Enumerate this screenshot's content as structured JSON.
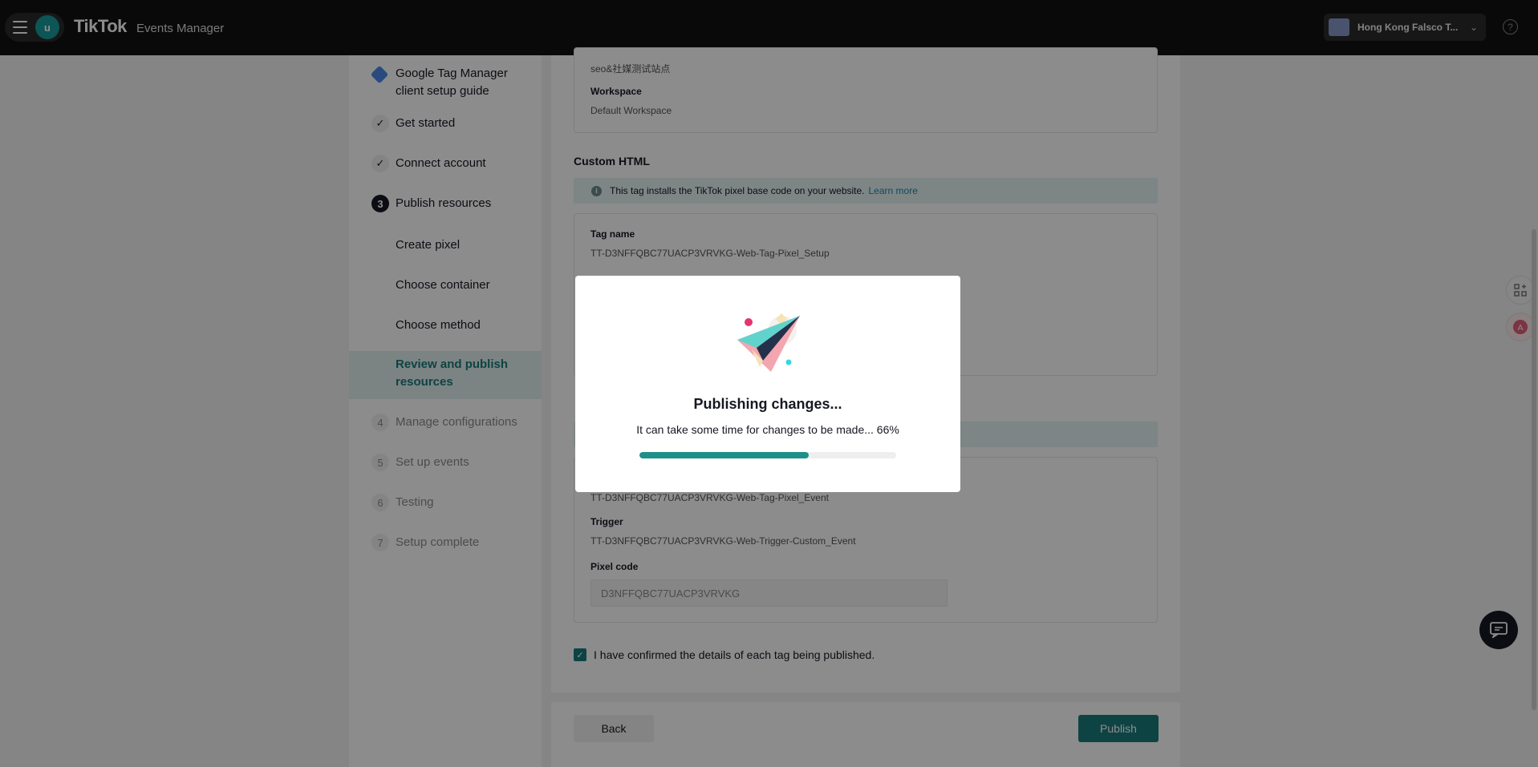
{
  "header": {
    "brand": "TikTok",
    "product": "Events Manager",
    "avatar_letter": "u",
    "account_name": "Hong Kong Falsco T...",
    "help": "?"
  },
  "sidebar": {
    "guide_title": "Google Tag Manager client setup guide",
    "steps": [
      {
        "label": "Get started",
        "mark": "✓",
        "state": "done"
      },
      {
        "label": "Connect account",
        "mark": "✓",
        "state": "done"
      },
      {
        "label": "Publish resources",
        "mark": "3",
        "state": "current"
      },
      {
        "label": "Manage configurations",
        "mark": "4",
        "state": "future"
      },
      {
        "label": "Set up events",
        "mark": "5",
        "state": "future"
      },
      {
        "label": "Testing",
        "mark": "6",
        "state": "future"
      },
      {
        "label": "Setup complete",
        "mark": "7",
        "state": "future"
      }
    ],
    "substeps": [
      {
        "label": "Create pixel"
      },
      {
        "label": "Choose container"
      },
      {
        "label": "Choose method"
      },
      {
        "label": "Review and publish resources",
        "active": true
      }
    ]
  },
  "main": {
    "top_card": {
      "site_value": "seo&社媒测试站点",
      "workspace_label": "Workspace",
      "workspace_value": "Default Workspace"
    },
    "custom_html": {
      "title": "Custom HTML",
      "info": "This tag installs the TikTok pixel base code on your website.",
      "learn_more": "Learn more",
      "tag_name_label": "Tag name",
      "tag_name_value": "TT-D3NFFQBC77UACP3VRVKG-Web-Tag-Pixel_Setup"
    },
    "event_card": {
      "tag_name_value": "TT-D3NFFQBC77UACP3VRVKG-Web-Tag-Pixel_Event",
      "trigger_label": "Trigger",
      "trigger_value": "TT-D3NFFQBC77UACP3VRVKG-Web-Trigger-Custom_Event",
      "pixel_code_label": "Pixel code",
      "pixel_code_value": "D3NFFQBC77UACP3VRVKG"
    },
    "confirm_text": "I have confirmed the details of each tag being published."
  },
  "footer": {
    "back": "Back",
    "publish": "Publish"
  },
  "modal": {
    "title": "Publishing changes...",
    "message": "It can take some time for changes to be made... 66%",
    "progress": 0.66
  },
  "colors": {
    "accent": "#1b7a7a",
    "progress": "#1f8f8a"
  }
}
